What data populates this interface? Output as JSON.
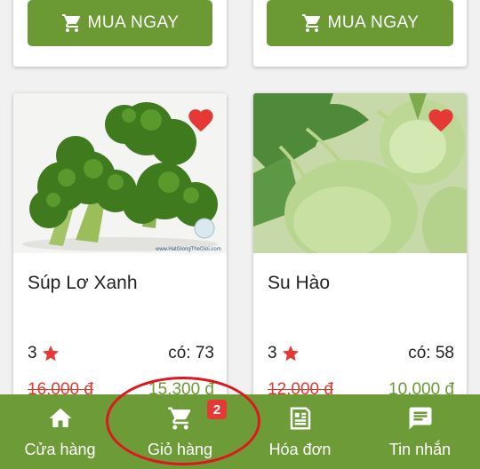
{
  "top_cards": [
    {
      "button_label": "MUA NGAY"
    },
    {
      "button_label": "MUA NGAY"
    }
  ],
  "products": [
    {
      "name": "Súp Lơ Xanh",
      "rating": "3",
      "stock": "có: 73",
      "old_price": "16.000 đ",
      "new_price": "15.300 đ",
      "watermark": "www.HatGiongTheGioi.com"
    },
    {
      "name": "Su Hào",
      "rating": "3",
      "stock": "có: 58",
      "old_price": "12.000 đ",
      "new_price": "10.000 đ"
    }
  ],
  "nav": {
    "items": [
      {
        "label": "Cửa hàng",
        "icon": "home-icon"
      },
      {
        "label": "Giỏ hàng",
        "icon": "cart-icon",
        "badge": "2"
      },
      {
        "label": "Hóa đơn",
        "icon": "receipt-icon"
      },
      {
        "label": "Tin nhắn",
        "icon": "message-icon"
      }
    ]
  },
  "colors": {
    "primary": "#6b9a35",
    "heart": "#e53935",
    "star": "#e53935",
    "old_price": "#e03a2f",
    "annotation": "#e0161e"
  }
}
